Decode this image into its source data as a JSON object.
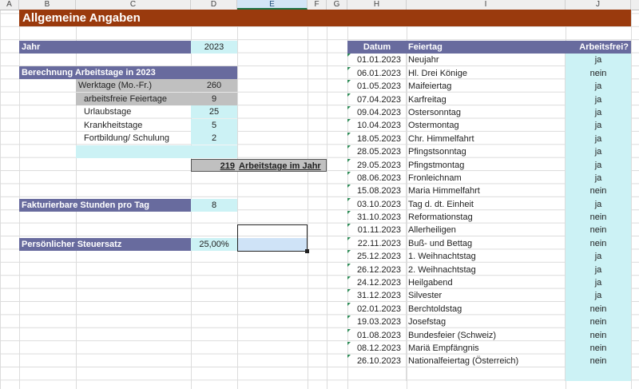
{
  "columns": [
    "A",
    "B",
    "C",
    "D",
    "E",
    "F",
    "G",
    "H",
    "I",
    "J"
  ],
  "title": "Allgemeine Angaben",
  "jahr": {
    "label": "Jahr",
    "value": "2023"
  },
  "berechnung": {
    "header": "Berechnung Arbeitstage in 2023",
    "rows": [
      {
        "label": "Werktage (Mo.-Fr.)",
        "value": "260"
      },
      {
        "label": "arbeitsfreie Feiertage",
        "value": "9"
      },
      {
        "label": "Urlaubstage",
        "value": "25"
      },
      {
        "label": "Krankheitstage",
        "value": "5"
      },
      {
        "label": "Fortbildung/ Schulung",
        "value": "2"
      }
    ],
    "result_value": "219",
    "result_label": "Arbeitstage im Jahr"
  },
  "fakturierbar": {
    "label": "Fakturierbare Stunden pro Tag",
    "value": "8"
  },
  "steuersatz": {
    "label": "Persönlicher Steuersatz",
    "value": "25,00%"
  },
  "holidays": {
    "headers": {
      "datum": "Datum",
      "feiertag": "Feiertag",
      "arbeitsfrei": "Arbeitsfrei?"
    },
    "rows": [
      {
        "datum": "01.01.2023",
        "feiertag": "Neujahr",
        "arbeitsfrei": "ja"
      },
      {
        "datum": "06.01.2023",
        "feiertag": "Hl. Drei Könige",
        "arbeitsfrei": "nein"
      },
      {
        "datum": "01.05.2023",
        "feiertag": "Maifeiertag",
        "arbeitsfrei": "ja"
      },
      {
        "datum": "07.04.2023",
        "feiertag": "Karfreitag",
        "arbeitsfrei": "ja"
      },
      {
        "datum": "09.04.2023",
        "feiertag": "Ostersonntag",
        "arbeitsfrei": "ja"
      },
      {
        "datum": "10.04.2023",
        "feiertag": "Ostermontag",
        "arbeitsfrei": "ja"
      },
      {
        "datum": "18.05.2023",
        "feiertag": "Chr. Himmelfahrt",
        "arbeitsfrei": "ja"
      },
      {
        "datum": "28.05.2023",
        "feiertag": "Pfingstsonntag",
        "arbeitsfrei": "ja"
      },
      {
        "datum": "29.05.2023",
        "feiertag": "Pfingstmontag",
        "arbeitsfrei": "ja"
      },
      {
        "datum": "08.06.2023",
        "feiertag": "Fronleichnam",
        "arbeitsfrei": "ja"
      },
      {
        "datum": "15.08.2023",
        "feiertag": "Maria Himmelfahrt",
        "arbeitsfrei": "nein"
      },
      {
        "datum": "03.10.2023",
        "feiertag": "Tag d. dt. Einheit",
        "arbeitsfrei": "ja"
      },
      {
        "datum": "31.10.2023",
        "feiertag": "Reformationstag",
        "arbeitsfrei": "nein"
      },
      {
        "datum": "01.11.2023",
        "feiertag": "Allerheiligen",
        "arbeitsfrei": "nein"
      },
      {
        "datum": "22.11.2023",
        "feiertag": "Buß- und Bettag",
        "arbeitsfrei": "nein"
      },
      {
        "datum": "25.12.2023",
        "feiertag": "1. Weihnachtstag",
        "arbeitsfrei": "ja"
      },
      {
        "datum": "26.12.2023",
        "feiertag": "2. Weihnachtstag",
        "arbeitsfrei": "ja"
      },
      {
        "datum": "24.12.2023",
        "feiertag": "Heilgabend",
        "arbeitsfrei": "ja"
      },
      {
        "datum": "31.12.2023",
        "feiertag": "Silvester",
        "arbeitsfrei": "ja"
      },
      {
        "datum": "02.01.2023",
        "feiertag": "Berchtoldstag",
        "arbeitsfrei": "nein"
      },
      {
        "datum": "19.03.2023",
        "feiertag": "Josefstag",
        "arbeitsfrei": "nein"
      },
      {
        "datum": "01.08.2023",
        "feiertag": "Bundesfeier (Schweiz)",
        "arbeitsfrei": "nein"
      },
      {
        "datum": "08.12.2023",
        "feiertag": "Mariä Empfängnis",
        "arbeitsfrei": "nein"
      },
      {
        "datum": "26.10.2023",
        "feiertag": "Nationalfeiertag (Österreich)",
        "arbeitsfrei": "nein"
      }
    ]
  },
  "colors": {
    "title": "#9a3a0d",
    "header": "#686b9e",
    "input": "#ccf2f5",
    "calc": "#c0c0c0"
  }
}
